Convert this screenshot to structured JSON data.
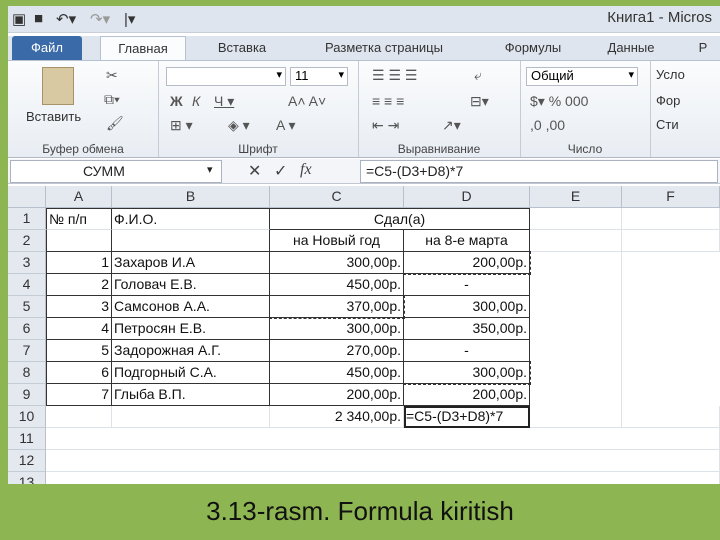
{
  "window": {
    "title": "Книга1 - Micros"
  },
  "tabs": [
    "Файл",
    "Главная",
    "Вставка",
    "Разметка страницы",
    "Формулы",
    "Данные",
    "Р"
  ],
  "ribbon": {
    "paste_label": "Вставить",
    "clipboard_group": "Буфер обмена",
    "font_size": "11",
    "font_group": "Шрифт",
    "align_group": "Выравнивание",
    "number_format": "Общий",
    "number_group": "Число",
    "styles_items": [
      "Усло",
      "Фор",
      "Сти"
    ]
  },
  "formula_bar": {
    "name_box": "СУММ",
    "formula": "=C5-(D3+D8)*7"
  },
  "columns": [
    "A",
    "B",
    "C",
    "D",
    "E",
    "F"
  ],
  "rows": [
    "1",
    "2",
    "3",
    "4",
    "5",
    "6",
    "7",
    "8",
    "9",
    "10",
    "11",
    "12",
    "13"
  ],
  "table": {
    "header_num": "№ п/п",
    "header_name": "Ф.И.О.",
    "header_sdal": "Сдал(а)",
    "sub_new_year": "на Новый год",
    "sub_march8": "на 8-е марта",
    "records": [
      {
        "n": "1",
        "name": "Захаров И.А",
        "c": "300,00р.",
        "d": "200,00р."
      },
      {
        "n": "2",
        "name": "Головач Е.В.",
        "c": "450,00р.",
        "d": "-"
      },
      {
        "n": "3",
        "name": "Самсонов А.А.",
        "c": "370,00р.",
        "d": "300,00р."
      },
      {
        "n": "4",
        "name": "Петросян Е.В.",
        "c": "300,00р.",
        "d": "350,00р."
      },
      {
        "n": "5",
        "name": "Задорожная А.Г.",
        "c": "270,00р.",
        "d": "-"
      },
      {
        "n": "6",
        "name": "Подгорный С.А.",
        "c": "450,00р.",
        "d": "300,00р."
      },
      {
        "n": "7",
        "name": "Глыба В.П.",
        "c": "200,00р.",
        "d": "200,00р."
      }
    ],
    "total_c": "2 340,00р.",
    "editing_d10": "=C5-(D3+D8)*7"
  },
  "caption": "3.13-rasm. Formula kiritish"
}
